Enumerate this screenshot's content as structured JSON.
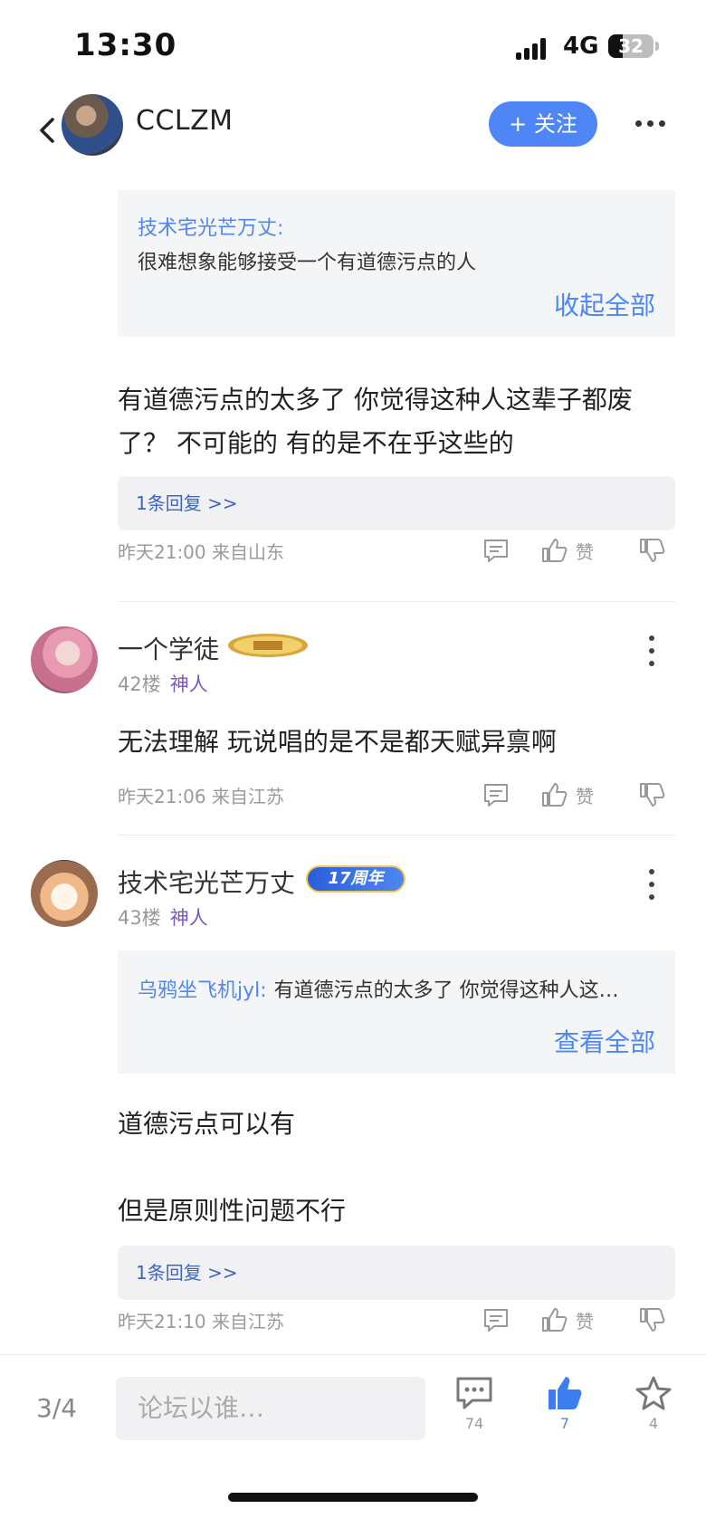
{
  "status_bar": {
    "time": "13:30",
    "network": "4G",
    "battery": "32",
    "battery_level": 0.32
  },
  "nav": {
    "title": "CCLZM",
    "follow_label": "+ 关注"
  },
  "floor41": {
    "quote": {
      "author": "技术宅光芒万丈:",
      "text": "很难想象能够接受一个有道德污点的人",
      "toggle_label": "收起全部"
    },
    "text_lines": [
      "有道德污点的太多了 你觉得这种人这辈子都废",
      "了？  不可能的 有的是不在乎这些的"
    ],
    "replies_label": "1条回复 >>",
    "meta": "昨天21:00 来自山东",
    "like_label": "赞"
  },
  "floor42": {
    "name": "一个学徒",
    "floor": "42楼",
    "rank": "神人",
    "text": "无法理解  玩说唱的是不是都天赋异禀啊",
    "meta": "昨天21:06 来自江苏",
    "like_label": "赞"
  },
  "floor43": {
    "name": "技术宅光芒万丈",
    "badge": "17周年",
    "floor": "43楼",
    "rank": "神人",
    "quote": {
      "author": "乌鸦坐飞机jyl:",
      "text": "有道德污点的太多了 你觉得这种人这…",
      "toggle_label": "查看全部"
    },
    "text_line1": "道德污点可以有",
    "text_line2": "但是原则性问题不行",
    "replies_label": "1条回复 >>",
    "meta": "昨天21:10 来自江苏",
    "like_label": "赞"
  },
  "bottom_bar": {
    "page_indicator": "3/4",
    "input_placeholder": "论坛以谁…",
    "comment_count": "74",
    "like_count": "7",
    "favorite_count": "4"
  },
  "colors": {
    "accent": "#4e86f5",
    "rank": "#7a55c6",
    "muted": "#9a9a9a"
  }
}
